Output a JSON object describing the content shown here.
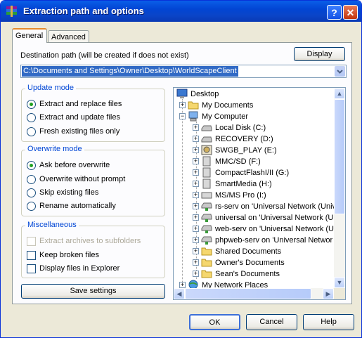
{
  "window": {
    "title": "Extraction path and options"
  },
  "tabs": [
    {
      "label": "General"
    },
    {
      "label": "Advanced"
    }
  ],
  "destination": {
    "label": "Destination path (will be created if does not exist)",
    "value": "C:\\Documents and Settings\\Owner\\Desktop\\WorldScapeClient",
    "display_button": "Display"
  },
  "update_mode": {
    "title": "Update mode",
    "options": [
      {
        "label": "Extract and replace files",
        "selected": true
      },
      {
        "label": "Extract and update files",
        "selected": false
      },
      {
        "label": "Fresh existing files only",
        "selected": false
      }
    ]
  },
  "overwrite_mode": {
    "title": "Overwrite mode",
    "options": [
      {
        "label": "Ask before overwrite",
        "selected": true
      },
      {
        "label": "Overwrite without prompt",
        "selected": false
      },
      {
        "label": "Skip existing files",
        "selected": false
      },
      {
        "label": "Rename automatically",
        "selected": false
      }
    ]
  },
  "misc": {
    "title": "Miscellaneous",
    "options": [
      {
        "label": "Extract archives to subfolders",
        "checked": false,
        "disabled": true
      },
      {
        "label": "Keep broken files",
        "checked": false,
        "disabled": false
      },
      {
        "label": "Display files in Explorer",
        "checked": false,
        "disabled": false
      }
    ]
  },
  "save_button": "Save settings",
  "tree": [
    {
      "label": "Desktop",
      "icon": "desktop-icon"
    },
    {
      "label": "My Documents",
      "icon": "folder-icon"
    },
    {
      "label": "My Computer",
      "icon": "computer-icon"
    },
    {
      "label": "Local Disk (C:)",
      "icon": "drive-icon"
    },
    {
      "label": "RECOVERY (D:)",
      "icon": "drive-icon"
    },
    {
      "label": "SWGB_PLAY (E:)",
      "icon": "cd-drive-icon"
    },
    {
      "label": "MMC/SD (F:)",
      "icon": "removable-drive-icon"
    },
    {
      "label": "CompactFlashI/II (G:)",
      "icon": "removable-drive-icon"
    },
    {
      "label": "SmartMedia (H:)",
      "icon": "removable-drive-icon"
    },
    {
      "label": "MS/MS Pro (I:)",
      "icon": "removable-drive-icon"
    },
    {
      "label": "rs-serv on 'Universal Network (Univ",
      "icon": "network-drive-icon"
    },
    {
      "label": "universal on 'Universal Network (U",
      "icon": "network-drive-icon"
    },
    {
      "label": "web-serv on 'Universal Network (U",
      "icon": "network-drive-icon"
    },
    {
      "label": "phpweb-serv on 'Universal Networ",
      "icon": "network-drive-icon"
    },
    {
      "label": "Shared Documents",
      "icon": "folder-icon"
    },
    {
      "label": "Owner's Documents",
      "icon": "folder-icon"
    },
    {
      "label": "Sean's Documents",
      "icon": "folder-icon"
    },
    {
      "label": "My Network Places",
      "icon": "network-places-icon"
    }
  ],
  "footer": {
    "ok": "OK",
    "cancel": "Cancel",
    "help": "Help"
  },
  "colors": {
    "titlebar": "#0245d3",
    "accent": "#0046d5",
    "selection": "#316ac5"
  }
}
